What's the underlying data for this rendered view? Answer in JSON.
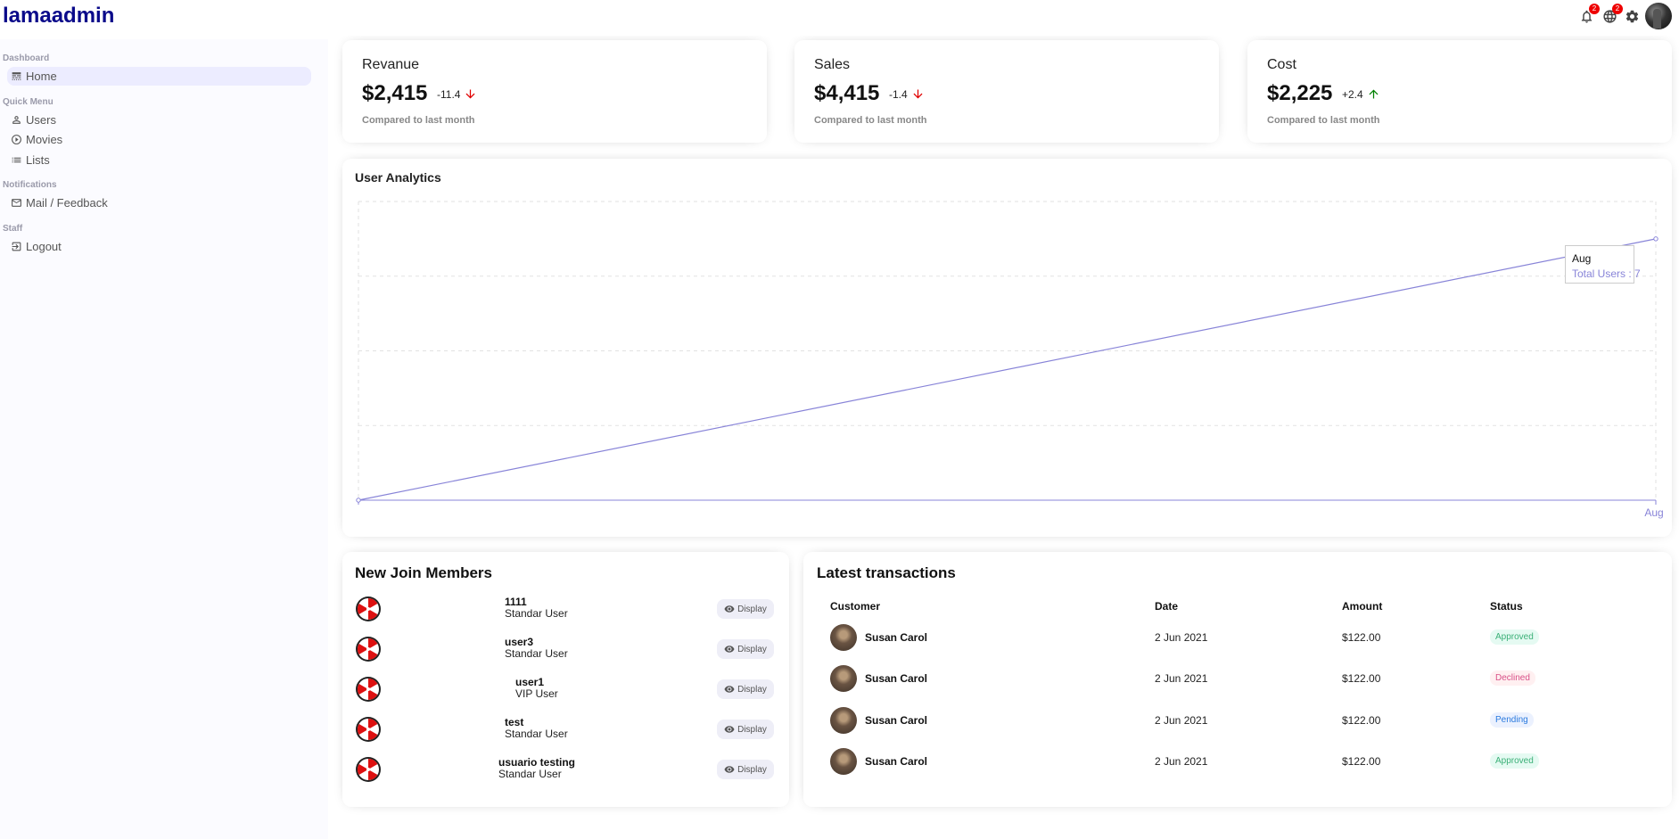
{
  "app": {
    "logo": "lamaadmin"
  },
  "topbar": {
    "notifications_count": "2",
    "language_count": "2"
  },
  "sidebar": {
    "sections": [
      {
        "title": "Dashboard",
        "items": [
          {
            "label": "Home",
            "icon": "line-style-icon",
            "active": true
          }
        ]
      },
      {
        "title": "Quick Menu",
        "items": [
          {
            "label": "Users",
            "icon": "person-icon"
          },
          {
            "label": "Movies",
            "icon": "play-circle-icon"
          },
          {
            "label": "Lists",
            "icon": "list-icon"
          }
        ]
      },
      {
        "title": "Notifications",
        "items": [
          {
            "label": "Mail / Feedback",
            "icon": "mail-icon"
          }
        ]
      },
      {
        "title": "Staff",
        "items": [
          {
            "label": "Logout",
            "icon": "logout-icon"
          }
        ]
      }
    ]
  },
  "featured": [
    {
      "title": "Revanue",
      "money": "$2,415",
      "rate": "-11.4",
      "trend": "down",
      "sub": "Compared to last month"
    },
    {
      "title": "Sales",
      "money": "$4,415",
      "rate": "-1.4",
      "trend": "down",
      "sub": "Compared to last month"
    },
    {
      "title": "Cost",
      "money": "$2,225",
      "rate": "+2.4",
      "trend": "up",
      "sub": "Compared to last month"
    }
  ],
  "colors": {
    "down": "#e00000",
    "up": "#008000",
    "line": "#8884d8",
    "logo": "#0a0a8a"
  },
  "analytics": {
    "title": "User Analytics",
    "tooltip_label": "Aug",
    "tooltip_value": "Total Users : 7"
  },
  "chart_data": {
    "type": "line",
    "title": "User Analytics",
    "x": [
      "",
      "Aug"
    ],
    "series": [
      {
        "name": "Total Users",
        "values": [
          0,
          7
        ]
      }
    ],
    "ylim": [
      0,
      8
    ],
    "grid": true,
    "xlabel": "",
    "ylabel": ""
  },
  "members": {
    "title": "New Join Members",
    "button_label": "Display",
    "items": [
      {
        "name": "1111",
        "role": "Standar User"
      },
      {
        "name": "user3",
        "role": "Standar User"
      },
      {
        "name": "user1",
        "role": "VIP User"
      },
      {
        "name": "test",
        "role": "Standar User"
      },
      {
        "name": "usuario testing",
        "role": "Standar User"
      }
    ]
  },
  "transactions": {
    "title": "Latest transactions",
    "headers": [
      "Customer",
      "Date",
      "Amount",
      "Status"
    ],
    "rows": [
      {
        "customer": "Susan Carol",
        "date": "2 Jun 2021",
        "amount": "$122.00",
        "status": "Approved"
      },
      {
        "customer": "Susan Carol",
        "date": "2 Jun 2021",
        "amount": "$122.00",
        "status": "Declined"
      },
      {
        "customer": "Susan Carol",
        "date": "2 Jun 2021",
        "amount": "$122.00",
        "status": "Pending"
      },
      {
        "customer": "Susan Carol",
        "date": "2 Jun 2021",
        "amount": "$122.00",
        "status": "Approved"
      }
    ]
  }
}
